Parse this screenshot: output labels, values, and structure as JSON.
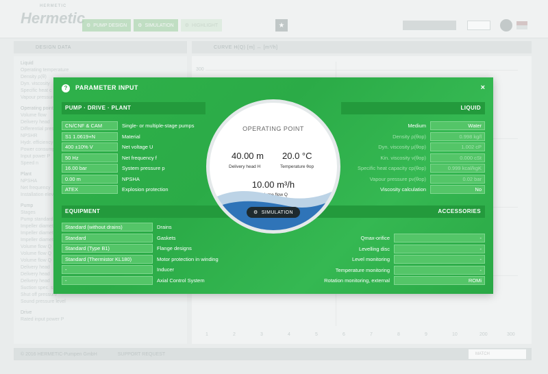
{
  "app": {
    "logo": "Hermetic",
    "logo_tag": "HERMETIC",
    "nav": [
      "PUMP DESIGN",
      "SIMULATION",
      "HIGHLIGHT"
    ],
    "left_section": "DESIGN DATA",
    "right_section": "CURVE H(Q) [m] ↔ [m³/h]",
    "bg_rows": [
      {
        "t": "Liquid",
        "h": true
      },
      {
        "t": "Operating temperature"
      },
      {
        "t": "Density ρ(θ)"
      },
      {
        "t": "Dyn. viscosity"
      },
      {
        "t": "Specific heat c"
      },
      {
        "t": "Vapour pressure"
      },
      {
        "t": "Operating point",
        "h": true
      },
      {
        "t": "Volume flow"
      },
      {
        "t": "Delivery head"
      },
      {
        "t": "Differential press."
      },
      {
        "t": "NPSHR"
      },
      {
        "t": "Hydr. efficiency"
      },
      {
        "t": "Power consumption"
      },
      {
        "t": "Input power P"
      },
      {
        "t": "Speed n"
      },
      {
        "t": "Plant",
        "h": true
      },
      {
        "t": "NPSHA"
      },
      {
        "t": "Net frequency"
      },
      {
        "t": "Installation elevation"
      },
      {
        "t": "Pump",
        "h": true
      },
      {
        "t": "Stages"
      },
      {
        "t": "Pump standard"
      },
      {
        "t": "Impeller diameter"
      },
      {
        "t": "Impeller diameter"
      },
      {
        "t": "Impeller diameter"
      },
      {
        "t": "Volume flow Q"
      },
      {
        "t": "Volume flow Q"
      },
      {
        "t": "Volume flow Q"
      },
      {
        "t": "Delivery head"
      },
      {
        "t": "Delivery head"
      },
      {
        "t": "Delivery head"
      },
      {
        "t": "Suction spec. speed"
      },
      {
        "t": "Shut off pressure"
      },
      {
        "t": "Sound pressure level"
      },
      {
        "t": "Drive",
        "h": true
      },
      {
        "t": "Rated input power P"
      }
    ],
    "chart_y_label": "300",
    "chart_x_ticks": [
      "1",
      "2",
      "3",
      "4",
      "5",
      "6",
      "7",
      "8",
      "9",
      "10",
      "200",
      "300"
    ],
    "footer_copy": "© 2016 HERMETIC-Pumpen GmbH",
    "footer_support": "SUPPORT REQUEST",
    "match_label": "MATCH"
  },
  "modal": {
    "title": "PARAMETER INPUT",
    "close": "×",
    "help": "?",
    "band_pump": "PUMP · DRIVE · PLANT",
    "band_liquid": "LIQUID",
    "band_equipment": "EQUIPMENT",
    "band_accessories": "ACCESSORIES",
    "pump_rows": [
      {
        "value": "CN/CNF & CAM",
        "label": "Single- or multiple-stage pumps"
      },
      {
        "value": "S1 1.0619+N",
        "label": "Material"
      },
      {
        "value": "400 ±10% V",
        "label": "Net voltage U"
      },
      {
        "value": "50 Hz",
        "label": "Net frequency f"
      },
      {
        "value": "16.00 bar",
        "label": "System pressure p"
      },
      {
        "value": "0.00 m",
        "label": "NPSHA"
      },
      {
        "value": "ATEX",
        "label": "Explosion protection"
      }
    ],
    "liquid_rows": [
      {
        "label": "Medium",
        "value": "Water",
        "faint": false
      },
      {
        "label": "Density ρ(θop)",
        "value": "0.998 kg/l",
        "faint": true
      },
      {
        "label": "Dyn. viscosity μ(θop)",
        "value": "1.002 cP",
        "faint": true
      },
      {
        "label": "Kin. viscosity ν(θop)",
        "value": "0.000 cSt",
        "faint": true
      },
      {
        "label": "Specific heat capacity cp(θop)",
        "value": "0.999 kcal/kgK",
        "faint": true
      },
      {
        "label": "Vapour pressure pv(θop)",
        "value": "0.02 bar",
        "faint": true
      },
      {
        "label": "Viscosity calculation",
        "value": "No",
        "faint": false
      }
    ],
    "equipment_rows": [
      {
        "value": "Standard (without drains)",
        "label": "Drains"
      },
      {
        "value": "Standard",
        "label": "Gaskets"
      },
      {
        "value": "Standard (Type B1)",
        "label": "Flange designs"
      },
      {
        "value": "Standard (Thermistor KL180)",
        "label": "Motor protection in winding"
      },
      {
        "value": "-",
        "label": "Inducer"
      },
      {
        "value": "-",
        "label": "Axial Control System"
      }
    ],
    "accessory_rows": [
      {
        "label": "Qmax-orifice",
        "value": "-"
      },
      {
        "label": "Levelling disc",
        "value": "-"
      },
      {
        "label": "Level monitoring",
        "value": "-"
      },
      {
        "label": "Temperature monitoring",
        "value": "-"
      },
      {
        "label": "Rotation monitoring, external",
        "value": "ROMi"
      }
    ],
    "operating_point": {
      "title": "OPERATING POINT",
      "head_value": "40.00 m",
      "head_label": "Delivery head H",
      "temp_value": "20.0 °C",
      "temp_label": "Temperature θop",
      "flow_value": "10.00 m³/h",
      "flow_label": "Volume flow Q",
      "simulation_button": "SIMULATION"
    }
  }
}
